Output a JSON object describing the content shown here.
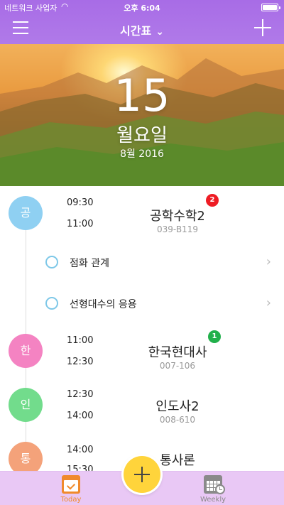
{
  "status_bar": {
    "carrier": "네트워크 사업자",
    "time": "오후 6:04"
  },
  "nav": {
    "title": "시간표"
  },
  "hero": {
    "day": "15",
    "weekday": "월요일",
    "month_year": "8월 2016"
  },
  "classes": [
    {
      "initial": "공",
      "start": "09:30",
      "end": "11:00",
      "name": "공학수학2",
      "room": "039-B119",
      "count": "2",
      "color": "#8fd0f2",
      "count_color": "#ee1c24"
    },
    {
      "initial": "한",
      "start": "11:00",
      "end": "12:30",
      "name": "한국현대사",
      "room": "007-106",
      "count": "1",
      "color": "#f483c2",
      "count_color": "#21b04b"
    },
    {
      "initial": "인",
      "start": "12:30",
      "end": "14:00",
      "name": "인도사2",
      "room": "008-610",
      "color": "#72dc8c"
    },
    {
      "initial": "통",
      "start": "14:00",
      "end": "15:30",
      "name": "통사론",
      "color": "#f4a27a"
    }
  ],
  "tasks": [
    {
      "label": "점화 관계"
    },
    {
      "label": "선형대수의 응용"
    }
  ],
  "tabs": {
    "today": "Today",
    "weekly": "Weekly"
  },
  "icons": [
    "wifi-icon",
    "battery-icon",
    "menu-icon",
    "chevron-down-icon",
    "plus-icon",
    "chevron-right-icon",
    "calendar-check-icon",
    "calendar-clock-icon"
  ]
}
